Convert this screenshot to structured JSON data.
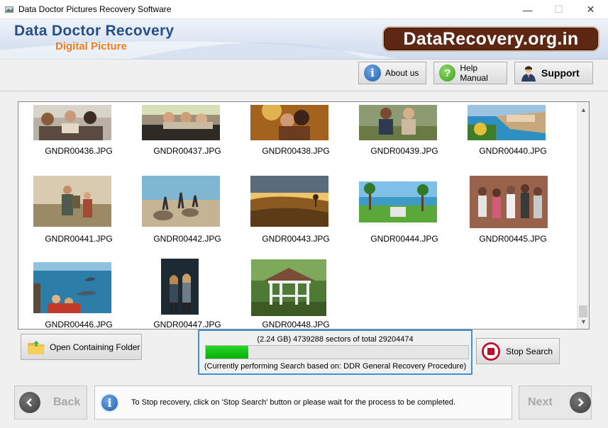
{
  "window": {
    "title": "Data Doctor Pictures Recovery Software",
    "min": "—",
    "max": "☐",
    "close": "✕"
  },
  "banner": {
    "title": "Data Doctor Recovery",
    "subtitle": "Digital Picture",
    "site": "DataRecovery.org.in"
  },
  "toolbar": {
    "about_label": "About us",
    "help_label": "Help Manual",
    "support_label": "Support"
  },
  "gallery": {
    "files": [
      "GNDR00436.JPG",
      "GNDR00437.JPG",
      "GNDR00438.JPG",
      "GNDR00439.JPG",
      "GNDR00440.JPG",
      "GNDR00441.JPG",
      "GNDR00442.JPG",
      "GNDR00443.JPG",
      "GNDR00444.JPG",
      "GNDR00445.JPG",
      "GNDR00446.JPG",
      "GNDR00447.JPG",
      "GNDR00448.JPG"
    ],
    "scroll_up": "▲",
    "scroll_down": "▼"
  },
  "actions": {
    "open_folder_label": "Open Containing Folder",
    "stop_label": "Stop Search"
  },
  "progress": {
    "sectors_text": "(2.24 GB) 4739288   sectors  of  total 29204474",
    "sectors_done": 4739288,
    "sectors_total": 29204474,
    "note": "(Currently performing Search based on:  DDR General Recovery Procedure)"
  },
  "footer": {
    "back_label": "Back",
    "next_label": "Next",
    "info_text": "To Stop recovery, click on 'Stop Search' button or please wait for the process to be completed."
  }
}
